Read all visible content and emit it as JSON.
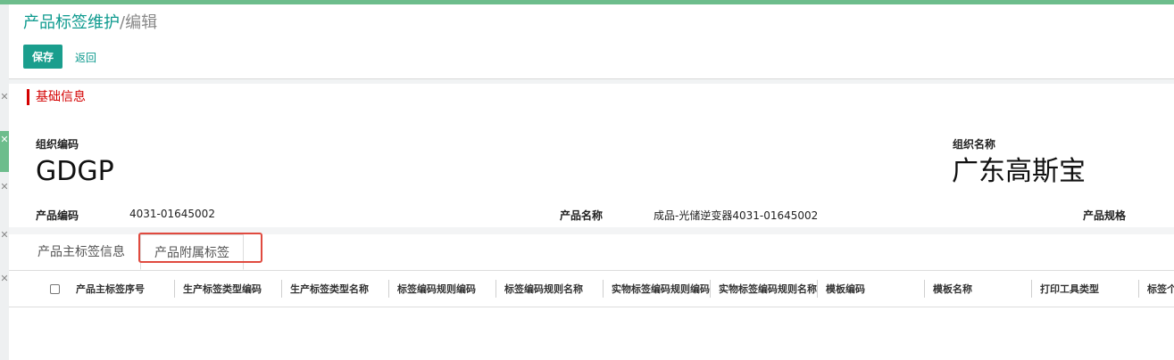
{
  "page": {
    "title_main": "产品标签维护",
    "title_sub": "/编辑"
  },
  "toolbar": {
    "save_label": "保存",
    "back_label": "返回"
  },
  "left_rail": {
    "close_glyph": "✕"
  },
  "section": {
    "title": "基础信息"
  },
  "form": {
    "org_code_label": "组织编码",
    "org_code_value": "GDGP",
    "org_name_label": "组织名称",
    "org_name_value": "广东高斯宝",
    "product_code_label": "产品编码",
    "product_code_value": "4031-01645002",
    "product_name_label": "产品名称",
    "product_name_value": "成品-光储逆变器4031-01645002",
    "product_spec_label": "产品规格"
  },
  "tabs": [
    {
      "label": "产品主标签信息",
      "active": false
    },
    {
      "label": "产品附属标签",
      "active": true
    }
  ],
  "grid": {
    "columns": [
      "产品主标签序号",
      "生产标签类型编码",
      "生产标签类型名称",
      "标签编码规则编码",
      "标签编码规则名称",
      "实物标签编码规则编码",
      "实物标签编码规则名称",
      "模板编码",
      "模板名称",
      "打印工具类型",
      "标签个"
    ]
  },
  "colors": {
    "accent": "#1a9e8d",
    "section_red": "#d40000",
    "highlight": "#e04a3f",
    "topbar": "#6dbd8c"
  }
}
